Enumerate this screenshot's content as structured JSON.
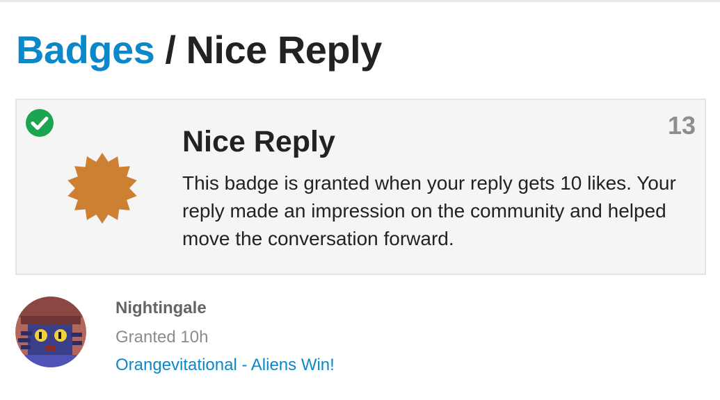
{
  "header": {
    "breadcrumb_link": "Badges",
    "separator": "/",
    "page_title": "Nice Reply"
  },
  "badge": {
    "name": "Nice Reply",
    "description": "This badge is granted when your reply gets 10 likes. Your reply made an impression on the community and helped move the conversation forward.",
    "grant_count": "13",
    "granted_to_viewer": true,
    "icon": "bronze-starburst-icon",
    "badge_color": "#cd7f32"
  },
  "grants": [
    {
      "username": "Nightingale",
      "granted_label": "Granted 10h",
      "topic": "Orangevitational - Aliens Win!"
    }
  ],
  "colors": {
    "link": "#0a88c9",
    "check": "#1ca551",
    "text": "#222222",
    "muted": "#8e8e8e"
  }
}
